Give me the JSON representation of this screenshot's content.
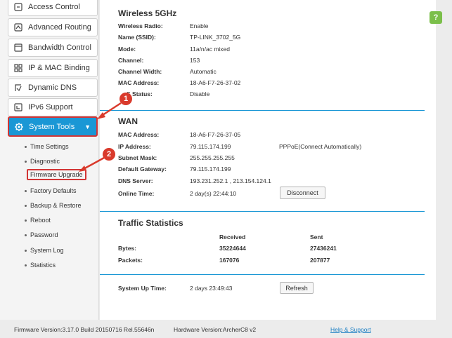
{
  "sidebar": {
    "items": [
      {
        "label": "Access Control",
        "icon": "access-control-icon"
      },
      {
        "label": "Advanced Routing",
        "icon": "routing-icon"
      },
      {
        "label": "Bandwidth Control",
        "icon": "bandwidth-icon"
      },
      {
        "label": "IP & MAC Binding",
        "icon": "binding-icon"
      },
      {
        "label": "Dynamic DNS",
        "icon": "ddns-icon"
      },
      {
        "label": "IPv6 Support",
        "icon": "ipv6-icon"
      },
      {
        "label": "System Tools",
        "icon": "gear-icon"
      }
    ],
    "subitems": [
      "Time Settings",
      "Diagnostic",
      "Firmware Upgrade",
      "Factory Defaults",
      "Backup & Restore",
      "Reboot",
      "Password",
      "System Log",
      "Statistics"
    ]
  },
  "wireless5g": {
    "title": "Wireless 5GHz",
    "rows": [
      {
        "label": "Wireless Radio:",
        "value": "Enable"
      },
      {
        "label": "Name (SSID):",
        "value": "TP-LINK_3702_5G"
      },
      {
        "label": "Mode:",
        "value": "11a/n/ac mixed"
      },
      {
        "label": "Channel:",
        "value": "153"
      },
      {
        "label": "Channel Width:",
        "value": "Automatic"
      },
      {
        "label": "MAC Address:",
        "value": "18-A6-F7-26-37-02"
      },
      {
        "label": "S Status:",
        "value": "Disable"
      }
    ]
  },
  "wan": {
    "title": "WAN",
    "rows": [
      {
        "label": "MAC Address:",
        "value": "18-A6-F7-26-37-05"
      },
      {
        "label": "IP Address:",
        "value": "79.115.174.199"
      },
      {
        "label": "Subnet Mask:",
        "value": "255.255.255.255"
      },
      {
        "label": "Default Gateway:",
        "value": "79.115.174.199"
      },
      {
        "label": "DNS Server:",
        "value": "193.231.252.1 , 213.154.124.1"
      },
      {
        "label": "Online Time:",
        "value": "2 day(s) 22:44:10"
      }
    ],
    "ip_note": "PPPoE(Connect Automatically)",
    "disconnect_label": "Disconnect"
  },
  "traffic": {
    "title": "Traffic Statistics",
    "col_received": "Received",
    "col_sent": "Sent",
    "rows": [
      {
        "label": "Bytes:",
        "received": "35224644",
        "sent": "27436241"
      },
      {
        "label": "Packets:",
        "received": "167076",
        "sent": "207877"
      }
    ]
  },
  "uptime": {
    "label": "System Up Time:",
    "value": "2 days 23:49:43",
    "refresh_label": "Refresh"
  },
  "footer": {
    "firmware": "Firmware Version:3.17.0 Build 20150716 Rel.55646n",
    "hardware": "Hardware Version:ArcherC8 v2",
    "help": "Help & Support"
  },
  "help_badge": "?",
  "annotations": {
    "one": "1",
    "two": "2",
    "color": "#d93a2c"
  }
}
